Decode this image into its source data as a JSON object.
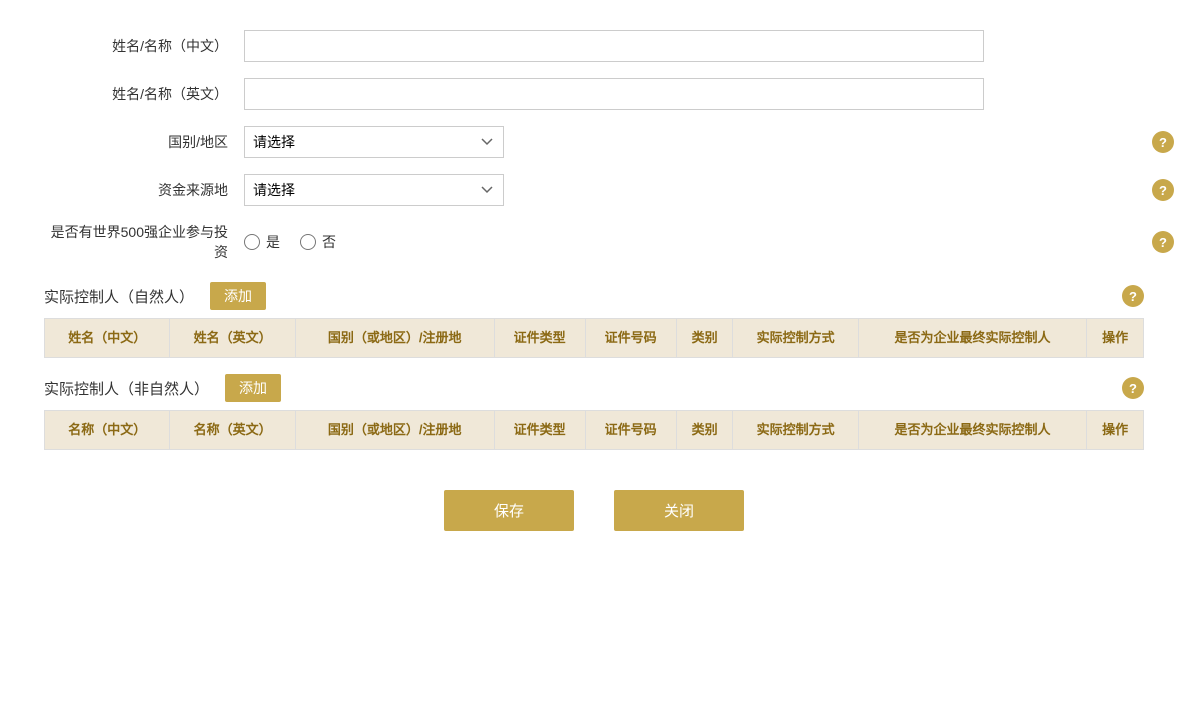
{
  "form": {
    "name_cn_label": "姓名/名称（中文）",
    "name_en_label": "姓名/名称（英文）",
    "country_label": "国别/地区",
    "country_placeholder": "请选择",
    "fund_source_label": "资金来源地",
    "fund_source_placeholder": "请选择",
    "fortune500_label": "是否有世界500强企业参与投资",
    "yes_label": "是",
    "no_label": "否"
  },
  "natural_controller": {
    "section_title": "实际控制人（自然人）",
    "add_label": "添加",
    "help_icon": "?",
    "columns": [
      "姓名（中文）",
      "姓名（英文）",
      "国别（或地区）/注册地",
      "证件类型",
      "证件号码",
      "类别",
      "实际控制方式",
      "是否为企业最终实际控制人",
      "操作"
    ]
  },
  "non_natural_controller": {
    "section_title": "实际控制人（非自然人）",
    "add_label": "添加",
    "help_icon": "?",
    "columns": [
      "名称（中文）",
      "名称（英文）",
      "国别（或地区）/注册地",
      "证件类型",
      "证件号码",
      "类别",
      "实际控制方式",
      "是否为企业最终实际控制人",
      "操作"
    ]
  },
  "footer": {
    "save_label": "保存",
    "close_label": "关闭"
  },
  "icons": {
    "help": "?"
  }
}
